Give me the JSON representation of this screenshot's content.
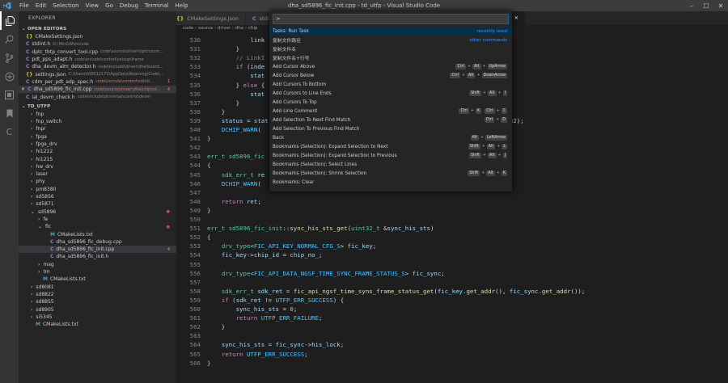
{
  "titlebar": {
    "menus": [
      "File",
      "Edit",
      "Selection",
      "View",
      "Go",
      "Debug",
      "Terminal",
      "Help"
    ],
    "title": "dha_sd5896_fic_init.cpp - td_utfp - Visual Studio Code"
  },
  "sidebar": {
    "title": "EXPLORER",
    "open_editors_label": "OPEN EDITORS",
    "open_editors": [
      {
        "icon": "{}",
        "icon_color": "#cbcb41",
        "name": "CMakeSettings.json",
        "desc": "",
        "badge": ""
      },
      {
        "icon": "C",
        "icon_color": "#a074c4",
        "name": "stdint.h",
        "desc": "D:\\MinGW\\include",
        "badge": ""
      },
      {
        "icon": "C",
        "icon_color": "#a074c4",
        "name": "dptc_tbtp_convert_tool.cpp",
        "desc": "code\\source\\driver\\dptc\\scrm...",
        "badge": ""
      },
      {
        "icon": "C",
        "icon_color": "#a074c4",
        "name": "pdt_pps_adapt.h",
        "desc": "code\\include\\control\\ce\\sup\\frame",
        "badge": ""
      },
      {
        "icon": "C",
        "icon_color": "#a074c4",
        "name": "dha_devm_alm_detector.h",
        "desc": "code\\include\\driver\\dha\\board...",
        "badge": ""
      },
      {
        "icon": "{}",
        "icon_color": "#cbcb41",
        "name": "settings.json",
        "desc": "C:\\Users\\t00512171\\AppData\\Roaming\\Code\\...",
        "badge": ""
      },
      {
        "icon": "C",
        "icon_color": "#a074c4",
        "name": "cdm_per_pdt_adp_spec.h",
        "desc": "code\\include\\control\\cdm\\t...",
        "badge": "1",
        "cls": "err"
      },
      {
        "icon": "C",
        "icon_color": "#a074c4",
        "name": "dha_sd5896_fic_init.cpp",
        "desc": "code\\source\\driver\\dha\\chip\\sd...",
        "badge": "4",
        "cls": "err",
        "sel": true
      },
      {
        "icon": "C",
        "icon_color": "#a074c4",
        "name": "ial_devm_check.h",
        "desc": "code\\include\\driver\\ial\\control\\devm",
        "badge": ""
      }
    ],
    "folder_label": "TD_UTFP",
    "tree": [
      {
        "label": "fnp",
        "arrow": "›",
        "indent": 1
      },
      {
        "label": "fnp_switch",
        "arrow": "›",
        "indent": 1
      },
      {
        "label": "fnpr",
        "arrow": "›",
        "indent": 1
      },
      {
        "label": "fpga",
        "arrow": "›",
        "indent": 1
      },
      {
        "label": "fpga_drv",
        "arrow": "›",
        "indent": 1
      },
      {
        "label": "hi1212",
        "arrow": "›",
        "indent": 1
      },
      {
        "label": "hi1215",
        "arrow": "›",
        "indent": 1
      },
      {
        "label": "hw_drv",
        "arrow": "›",
        "indent": 1
      },
      {
        "label": "laser",
        "arrow": "›",
        "indent": 1
      },
      {
        "label": "phy",
        "arrow": "›",
        "indent": 1
      },
      {
        "label": "pm8380",
        "arrow": "›",
        "indent": 1
      },
      {
        "label": "sd5856",
        "arrow": "›",
        "indent": 1
      },
      {
        "label": "sd5871",
        "arrow": "›",
        "indent": 1
      },
      {
        "label": "sd5896",
        "arrow": "⌄",
        "indent": 1,
        "cls": "err",
        "dot": true
      },
      {
        "label": "fe",
        "arrow": "›",
        "indent": 2
      },
      {
        "label": "fic",
        "arrow": "⌄",
        "indent": 2,
        "cls": "err",
        "dot": true
      },
      {
        "label": "CMakeLists.txt",
        "arrow": "",
        "icon": "M",
        "indent": 3
      },
      {
        "label": "dha_sd5896_fic_debug.cpp",
        "arrow": "",
        "icon": "C",
        "indent": 3
      },
      {
        "label": "dha_sd5896_fic_init.cpp",
        "arrow": "",
        "icon": "C",
        "indent": 3,
        "cls": "err",
        "sel": true,
        "badge": "4"
      },
      {
        "label": "dha_sd5896_fic_init.h",
        "arrow": "",
        "icon": "C",
        "indent": 3
      },
      {
        "label": "mag",
        "arrow": "›",
        "indent": 2
      },
      {
        "label": "tm",
        "arrow": "›",
        "indent": 2
      },
      {
        "label": "CMakeLists.txt",
        "arrow": "",
        "icon": "M",
        "indent": 2
      },
      {
        "label": "sd8081",
        "arrow": "›",
        "indent": 1
      },
      {
        "label": "sd8822",
        "arrow": "›",
        "indent": 1
      },
      {
        "label": "sd8855",
        "arrow": "›",
        "indent": 1
      },
      {
        "label": "sd8905",
        "arrow": "›",
        "indent": 1
      },
      {
        "label": "si5345",
        "arrow": "›",
        "indent": 1
      },
      {
        "label": "CMakeLists.txt",
        "arrow": "",
        "icon": "M",
        "indent": 1
      }
    ]
  },
  "tabs": [
    {
      "label": "CMakeSettings.json",
      "icon": "{}",
      "active": false
    },
    {
      "label": "stdint.h",
      "icon": "C",
      "active": false
    },
    {
      "label": "",
      "icon": "",
      "active": false
    },
    {
      "label": "settings.json",
      "icon": "{}",
      "active": false
    },
    {
      "label": "cdm_per_pdt_adp_spec.h",
      "icon": "C",
      "active": false
    },
    {
      "label": "dha_sd5896_fic_init.cpp",
      "icon": "C",
      "active": true
    }
  ],
  "breadcrumb": "code › source › driver › dha › chip",
  "palette": {
    "input": ">",
    "items": [
      {
        "label": "Tasks: Run Task",
        "right": "recently used",
        "keys": [],
        "sel": true
      },
      {
        "label": "复制文件路径",
        "right": "other commands",
        "keys": []
      },
      {
        "label": "复制文件名",
        "right": "",
        "keys": []
      },
      {
        "label": "复制文件名+行号",
        "right": "",
        "keys": []
      },
      {
        "label": "Add Cursor Above",
        "right": "",
        "keys": [
          "Ctrl",
          "Alt",
          "UpArrow"
        ]
      },
      {
        "label": "Add Cursor Below",
        "right": "",
        "keys": [
          "Ctrl",
          "Alt",
          "DownArrow"
        ]
      },
      {
        "label": "Add Cursors To Bottom",
        "right": "",
        "keys": []
      },
      {
        "label": "Add Cursors to Line Ends",
        "right": "",
        "keys": [
          "Shift",
          "Alt",
          "I"
        ]
      },
      {
        "label": "Add Cursors To Top",
        "right": "",
        "keys": []
      },
      {
        "label": "Add Line Comment",
        "right": "",
        "keys": [
          "Ctrl",
          "K",
          "Ctrl",
          "C"
        ]
      },
      {
        "label": "Add Selection To Next Find Match",
        "right": "",
        "keys": [
          "Ctrl",
          "D"
        ]
      },
      {
        "label": "Add Selection To Previous Find Match",
        "right": "",
        "keys": []
      },
      {
        "label": "Back",
        "right": "",
        "keys": [
          "Alt",
          "LeftArrow"
        ]
      },
      {
        "label": "Bookmarks (Selection): Expand Selection to Next",
        "right": "",
        "keys": [
          "Shift",
          "Alt",
          "L"
        ]
      },
      {
        "label": "Bookmarks (Selection): Expand Selection to Previous",
        "right": "",
        "keys": [
          "Shift",
          "Alt",
          "J"
        ]
      },
      {
        "label": "Bookmarks (Selection): Select Lines",
        "right": "",
        "keys": []
      },
      {
        "label": "Bookmarks (Selection): Shrink Selection",
        "right": "",
        "keys": [
          "Shift",
          "Alt",
          "K"
        ]
      },
      {
        "label": "Bookmarks: Clear",
        "right": "",
        "keys": []
      }
    ]
  },
  "code": {
    "lines": [
      {
        "n": "530",
        "html": "            <span class='v'>link</span>"
      },
      {
        "n": "531",
        "html": "        }"
      },
      {
        "n": "532",
        "html": "        <span class='cm'>// LinkI</span>"
      },
      {
        "n": "533",
        "html": "        <span class='c'>if</span> (<span class='v'>inde</span>"
      },
      {
        "n": "534",
        "html": "            <span class='v'>stat</span>"
      },
      {
        "n": "535",
        "html": "        } <span class='c'>else</span> {"
      },
      {
        "n": "536",
        "html": "            <span class='v'>stat</span>"
      },
      {
        "n": "537",
        "html": "        }"
      },
      {
        "n": "538",
        "html": "    }"
      },
      {
        "n": "539",
        "html": "    <span class='v'>status</span> = <span class='v'>stat</span>                                                        <span class='v'>high24</span>) << <span class='n'>32</span>);"
      },
      {
        "n": "540",
        "html": "    <span class='m'>DCHIP_WARN</span>(                                                         <span class='v'>tus_high24</span>);"
      },
      {
        "n": "541",
        "html": "}"
      },
      {
        "n": "542",
        "html": ""
      },
      {
        "n": "543",
        "html": "<span class='t'>err_t</span> <span class='t'>sd5896_fic</span>"
      },
      {
        "n": "544",
        "html": "{"
      },
      {
        "n": "545",
        "html": "    <span class='t'>sdk_err_t</span> <span class='v'>re</span>"
      },
      {
        "n": "546",
        "html": "    <span class='m'>DCHIP_WARN</span>("
      },
      {
        "n": "547",
        "html": ""
      },
      {
        "n": "548",
        "html": "    <span class='c'>return</span> <span class='v'>ret</span>;"
      },
      {
        "n": "549",
        "html": "}"
      },
      {
        "n": "550",
        "html": ""
      },
      {
        "n": "551",
        "html": "<span class='t'>err_t</span> <span class='t'>sd5896_fic_init</span>::<span class='f'>sync_his_sts_get</span>(<span class='t'>uint32_t</span> &<span class='v'>sync_his_sts</span>)"
      },
      {
        "n": "552",
        "html": "{"
      },
      {
        "n": "553",
        "html": "    <span class='t'>drv_type</span>&lt;<span class='m'>FIC_API_KEY_NORMAL_CFG_S</span>&gt; <span class='v'>fic_key</span>;"
      },
      {
        "n": "554",
        "html": "    <span class='v'>fic_key</span>-><span class='v'>chip_id</span> = <span class='v'>chip_no_</span>;"
      },
      {
        "n": "555",
        "html": ""
      },
      {
        "n": "556",
        "html": "    <span class='t'>drv_type</span>&lt;<span class='m'>FIC_API_DATA_NGSF_TIME_SYNC_FRAME_STATUS_S</span>&gt; <span class='v'>fic_sync</span>;"
      },
      {
        "n": "557",
        "html": ""
      },
      {
        "n": "558",
        "html": "    <span class='t'>sdk_err_t</span> <span class='v'>sdk_ret</span> = <span class='f'>fic_api_ngsf_time_syns_frame_status_get</span>(<span class='v'>fic_key</span>.<span class='f'>get_addr</span>(), <span class='v'>fic_sync</span>.<span class='f'>get_addr</span>());"
      },
      {
        "n": "559",
        "html": "    <span class='c'>if</span> (<span class='v'>sdk_ret</span> != <span class='m'>UTFP_ERR_SUCCESS</span>) {"
      },
      {
        "n": "560",
        "html": "        <span class='v'>sync_his_sts</span> = <span class='n'>0</span>;"
      },
      {
        "n": "561",
        "html": "        <span class='c'>return</span> <span class='m'>UTFP_ERR_FAILURE</span>;"
      },
      {
        "n": "562",
        "html": "    }"
      },
      {
        "n": "563",
        "html": ""
      },
      {
        "n": "564",
        "html": "    <span class='v'>sync_his_sts</span> = <span class='v'>fic_sync</span>-><span class='v'>his_lock</span>;"
      },
      {
        "n": "565",
        "html": "    <span class='c'>return</span> <span class='m'>UTFP_ERR_SUCCESS</span>;"
      },
      {
        "n": "566",
        "html": "}"
      }
    ]
  }
}
